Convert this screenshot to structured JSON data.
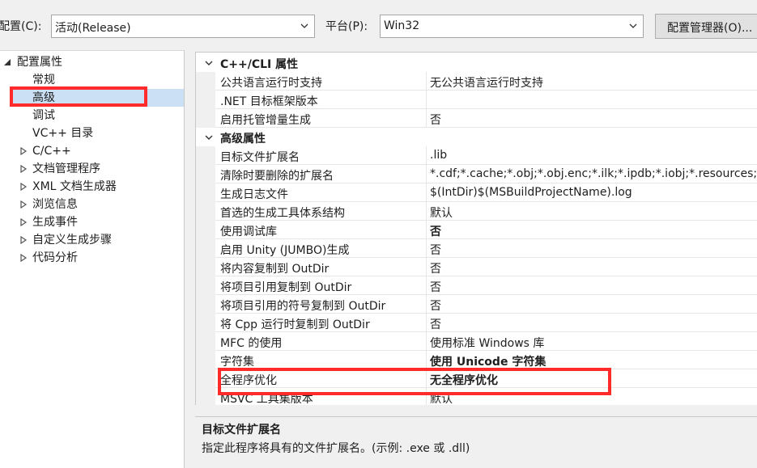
{
  "toolbar": {
    "config_label": "配置(C):",
    "config_value": "活动(Release)",
    "platform_label": "平台(P):",
    "platform_value": "Win32",
    "manager_button": "配置管理器(O)..."
  },
  "tree": {
    "root": "配置属性",
    "items": [
      {
        "label": "常规",
        "expandable": false,
        "selected": false
      },
      {
        "label": "高级",
        "expandable": false,
        "selected": true
      },
      {
        "label": "调试",
        "expandable": false,
        "selected": false
      },
      {
        "label": "VC++ 目录",
        "expandable": false,
        "selected": false
      },
      {
        "label": "C/C++",
        "expandable": true,
        "selected": false
      },
      {
        "label": "文档管理程序",
        "expandable": true,
        "selected": false
      },
      {
        "label": "XML 文档生成器",
        "expandable": true,
        "selected": false
      },
      {
        "label": "浏览信息",
        "expandable": true,
        "selected": false
      },
      {
        "label": "生成事件",
        "expandable": true,
        "selected": false
      },
      {
        "label": "自定义生成步骤",
        "expandable": true,
        "selected": false
      },
      {
        "label": "代码分析",
        "expandable": true,
        "selected": false
      }
    ]
  },
  "grid": {
    "categories": [
      {
        "title": "C++/CLI 属性",
        "props": [
          {
            "name": "公共语言运行时支持",
            "value": "无公共语言运行时支持",
            "bold": false
          },
          {
            "name": ".NET 目标框架版本",
            "value": "",
            "bold": false
          },
          {
            "name": "启用托管增量生成",
            "value": "否",
            "bold": false
          }
        ]
      },
      {
        "title": "高级属性",
        "props": [
          {
            "name": "目标文件扩展名",
            "value": ".lib",
            "bold": false
          },
          {
            "name": "清除时要删除的扩展名",
            "value": "*.cdf;*.cache;*.obj;*.obj.enc;*.ilk;*.ipdb;*.iobj;*.resources;*.tlb;*.tli;",
            "bold": false
          },
          {
            "name": "生成日志文件",
            "value": "$(IntDir)$(MSBuildProjectName).log",
            "bold": false
          },
          {
            "name": "首选的生成工具体系结构",
            "value": "默认",
            "bold": false
          },
          {
            "name": "使用调试库",
            "value": "否",
            "bold": true
          },
          {
            "name": "启用 Unity (JUMBO)生成",
            "value": "否",
            "bold": false
          },
          {
            "name": "将内容复制到 OutDir",
            "value": "否",
            "bold": false
          },
          {
            "name": "将项目引用复制到 OutDir",
            "value": "否",
            "bold": false
          },
          {
            "name": "将项目引用的符号复制到 OutDir",
            "value": "否",
            "bold": false
          },
          {
            "name": "将 Cpp 运行时复制到 OutDir",
            "value": "否",
            "bold": false
          },
          {
            "name": "MFC 的使用",
            "value": "使用标准 Windows 库",
            "bold": false
          },
          {
            "name": "字符集",
            "value": "使用 Unicode 字符集",
            "bold": true
          },
          {
            "name": "全程序优化",
            "value": "无全程序优化",
            "bold": true
          },
          {
            "name": "MSVC 工具集版本",
            "value": "默认",
            "bold": false
          }
        ]
      }
    ]
  },
  "description": {
    "title": "目标文件扩展名",
    "text": "指定此程序将具有的文件扩展名。(示例: .exe 或 .dll)"
  },
  "colors": {
    "highlight_box": "#ff2a2a",
    "selection": "#cce0f5",
    "window_bg": "#f0f0f0"
  }
}
